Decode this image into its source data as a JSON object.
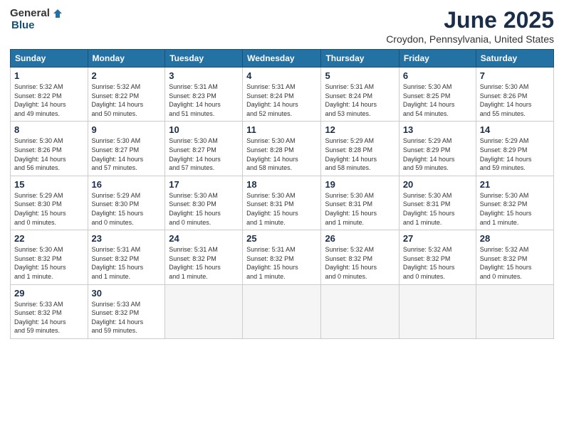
{
  "logo": {
    "general": "General",
    "blue": "Blue"
  },
  "title": "June 2025",
  "subtitle": "Croydon, Pennsylvania, United States",
  "headers": [
    "Sunday",
    "Monday",
    "Tuesday",
    "Wednesday",
    "Thursday",
    "Friday",
    "Saturday"
  ],
  "weeks": [
    [
      {
        "num": "1",
        "info": "Sunrise: 5:32 AM\nSunset: 8:22 PM\nDaylight: 14 hours\nand 49 minutes."
      },
      {
        "num": "2",
        "info": "Sunrise: 5:32 AM\nSunset: 8:22 PM\nDaylight: 14 hours\nand 50 minutes."
      },
      {
        "num": "3",
        "info": "Sunrise: 5:31 AM\nSunset: 8:23 PM\nDaylight: 14 hours\nand 51 minutes."
      },
      {
        "num": "4",
        "info": "Sunrise: 5:31 AM\nSunset: 8:24 PM\nDaylight: 14 hours\nand 52 minutes."
      },
      {
        "num": "5",
        "info": "Sunrise: 5:31 AM\nSunset: 8:24 PM\nDaylight: 14 hours\nand 53 minutes."
      },
      {
        "num": "6",
        "info": "Sunrise: 5:30 AM\nSunset: 8:25 PM\nDaylight: 14 hours\nand 54 minutes."
      },
      {
        "num": "7",
        "info": "Sunrise: 5:30 AM\nSunset: 8:26 PM\nDaylight: 14 hours\nand 55 minutes."
      }
    ],
    [
      {
        "num": "8",
        "info": "Sunrise: 5:30 AM\nSunset: 8:26 PM\nDaylight: 14 hours\nand 56 minutes."
      },
      {
        "num": "9",
        "info": "Sunrise: 5:30 AM\nSunset: 8:27 PM\nDaylight: 14 hours\nand 57 minutes."
      },
      {
        "num": "10",
        "info": "Sunrise: 5:30 AM\nSunset: 8:27 PM\nDaylight: 14 hours\nand 57 minutes."
      },
      {
        "num": "11",
        "info": "Sunrise: 5:30 AM\nSunset: 8:28 PM\nDaylight: 14 hours\nand 58 minutes."
      },
      {
        "num": "12",
        "info": "Sunrise: 5:29 AM\nSunset: 8:28 PM\nDaylight: 14 hours\nand 58 minutes."
      },
      {
        "num": "13",
        "info": "Sunrise: 5:29 AM\nSunset: 8:29 PM\nDaylight: 14 hours\nand 59 minutes."
      },
      {
        "num": "14",
        "info": "Sunrise: 5:29 AM\nSunset: 8:29 PM\nDaylight: 14 hours\nand 59 minutes."
      }
    ],
    [
      {
        "num": "15",
        "info": "Sunrise: 5:29 AM\nSunset: 8:30 PM\nDaylight: 15 hours\nand 0 minutes."
      },
      {
        "num": "16",
        "info": "Sunrise: 5:29 AM\nSunset: 8:30 PM\nDaylight: 15 hours\nand 0 minutes."
      },
      {
        "num": "17",
        "info": "Sunrise: 5:30 AM\nSunset: 8:30 PM\nDaylight: 15 hours\nand 0 minutes."
      },
      {
        "num": "18",
        "info": "Sunrise: 5:30 AM\nSunset: 8:31 PM\nDaylight: 15 hours\nand 1 minute."
      },
      {
        "num": "19",
        "info": "Sunrise: 5:30 AM\nSunset: 8:31 PM\nDaylight: 15 hours\nand 1 minute."
      },
      {
        "num": "20",
        "info": "Sunrise: 5:30 AM\nSunset: 8:31 PM\nDaylight: 15 hours\nand 1 minute."
      },
      {
        "num": "21",
        "info": "Sunrise: 5:30 AM\nSunset: 8:32 PM\nDaylight: 15 hours\nand 1 minute."
      }
    ],
    [
      {
        "num": "22",
        "info": "Sunrise: 5:30 AM\nSunset: 8:32 PM\nDaylight: 15 hours\nand 1 minute."
      },
      {
        "num": "23",
        "info": "Sunrise: 5:31 AM\nSunset: 8:32 PM\nDaylight: 15 hours\nand 1 minute."
      },
      {
        "num": "24",
        "info": "Sunrise: 5:31 AM\nSunset: 8:32 PM\nDaylight: 15 hours\nand 1 minute."
      },
      {
        "num": "25",
        "info": "Sunrise: 5:31 AM\nSunset: 8:32 PM\nDaylight: 15 hours\nand 1 minute."
      },
      {
        "num": "26",
        "info": "Sunrise: 5:32 AM\nSunset: 8:32 PM\nDaylight: 15 hours\nand 0 minutes."
      },
      {
        "num": "27",
        "info": "Sunrise: 5:32 AM\nSunset: 8:32 PM\nDaylight: 15 hours\nand 0 minutes."
      },
      {
        "num": "28",
        "info": "Sunrise: 5:32 AM\nSunset: 8:32 PM\nDaylight: 15 hours\nand 0 minutes."
      }
    ],
    [
      {
        "num": "29",
        "info": "Sunrise: 5:33 AM\nSunset: 8:32 PM\nDaylight: 14 hours\nand 59 minutes."
      },
      {
        "num": "30",
        "info": "Sunrise: 5:33 AM\nSunset: 8:32 PM\nDaylight: 14 hours\nand 59 minutes."
      },
      {
        "num": "",
        "info": ""
      },
      {
        "num": "",
        "info": ""
      },
      {
        "num": "",
        "info": ""
      },
      {
        "num": "",
        "info": ""
      },
      {
        "num": "",
        "info": ""
      }
    ]
  ]
}
